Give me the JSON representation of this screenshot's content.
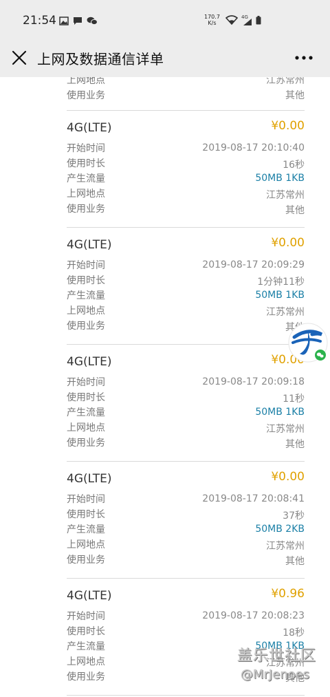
{
  "statusbar": {
    "time": "21:54",
    "speed_top": "170.7",
    "speed_unit": "K/s",
    "network": "4G"
  },
  "navbar": {
    "title": "上网及数据通信详单"
  },
  "labels": {
    "start_time": "开始时间",
    "duration": "使用时长",
    "flow": "产生流量",
    "location": "上网地点",
    "service": "使用业务"
  },
  "partial_record": {
    "location": "江苏常州",
    "service": "其他"
  },
  "records": [
    {
      "type": "4G(LTE)",
      "amount": "¥0.00",
      "start_time": "2019-08-17 20:10:40",
      "duration": "16秒",
      "flow": "50MB 1KB",
      "location": "江苏常州",
      "service": "其他"
    },
    {
      "type": "4G(LTE)",
      "amount": "¥0.00",
      "start_time": "2019-08-17 20:09:29",
      "duration": "1分钟11秒",
      "flow": "50MB 1KB",
      "location": "江苏常州",
      "service": "其他"
    },
    {
      "type": "4G(LTE)",
      "amount": "¥0.00",
      "start_time": "2019-08-17 20:09:18",
      "duration": "11秒",
      "flow": "50MB 1KB",
      "location": "江苏常州",
      "service": "其他"
    },
    {
      "type": "4G(LTE)",
      "amount": "¥0.00",
      "start_time": "2019-08-17 20:08:41",
      "duration": "37秒",
      "flow": "50MB 2KB",
      "location": "江苏常州",
      "service": "其他"
    },
    {
      "type": "4G(LTE)",
      "amount": "¥0.96",
      "start_time": "2019-08-17 20:08:23",
      "duration": "18秒",
      "flow": "50MB 1KB",
      "location": "江苏常州",
      "service": "其他"
    }
  ],
  "watermark": {
    "line1": "盖乐世社区",
    "line2": "@MrJenoes"
  },
  "colors": {
    "amount": "#e0a100",
    "flow": "#1a7fa6",
    "logo": "#1a63b8"
  }
}
